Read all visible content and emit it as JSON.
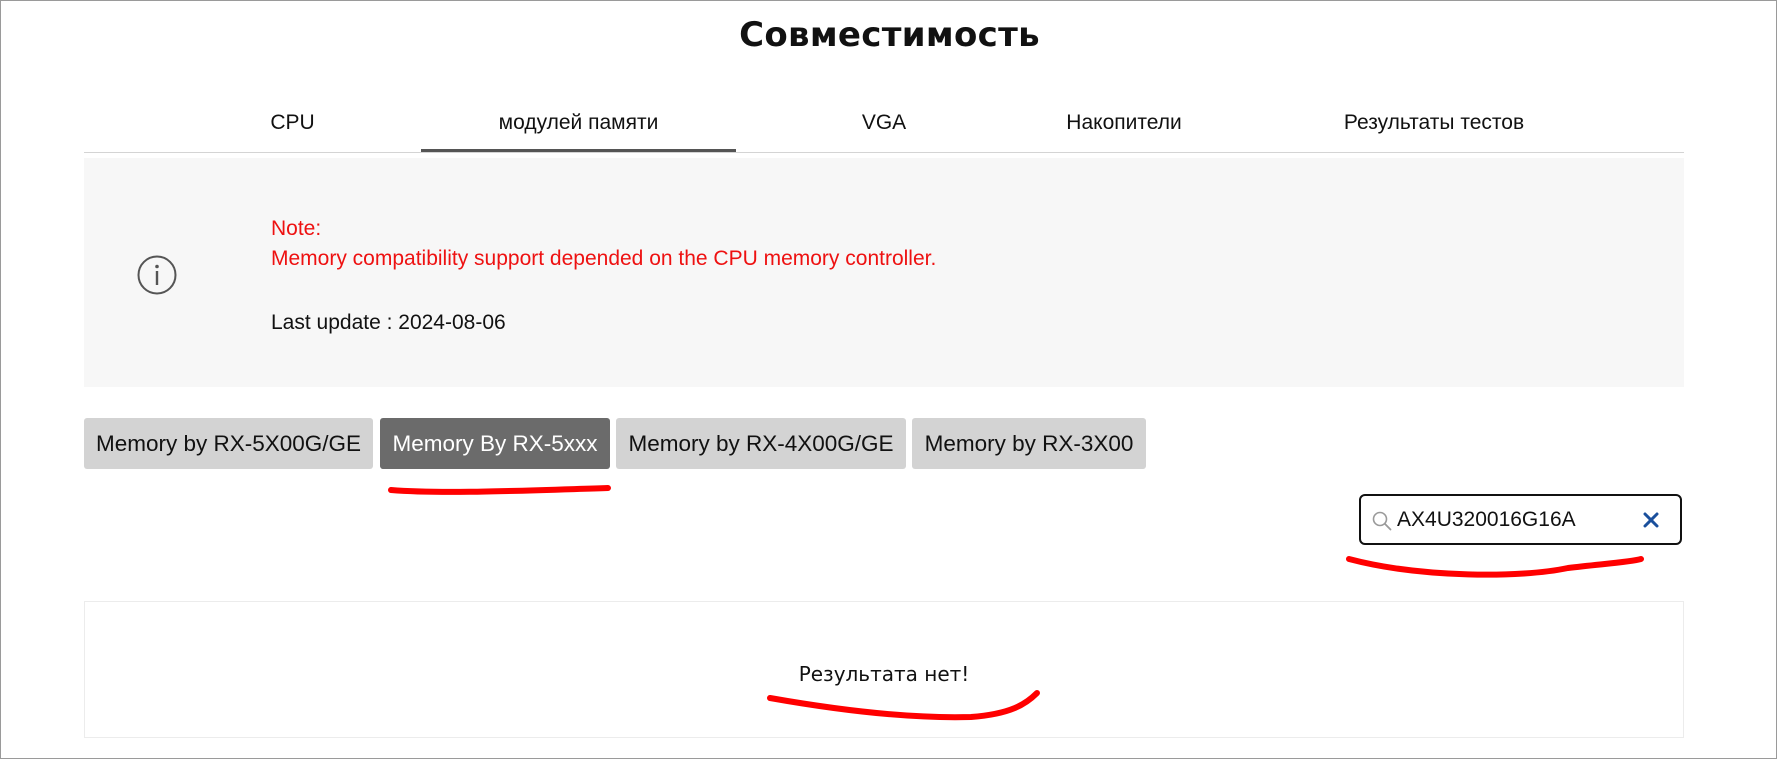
{
  "page": {
    "title": "Совместимость"
  },
  "tabs": [
    {
      "label": "CPU",
      "active": false
    },
    {
      "label": "модулей памяти",
      "active": true
    },
    {
      "label": "VGA",
      "active": false
    },
    {
      "label": "Накопители",
      "active": false
    },
    {
      "label": "Результаты тестов",
      "active": false
    }
  ],
  "note": {
    "icon": "info-icon",
    "label": "Note:",
    "text": "Memory compatibility support depended on the CPU memory controller.",
    "last_update": "Last update : 2024-08-06"
  },
  "memory_buttons": [
    {
      "label": "Memory by RX-5X00G/GE",
      "active": false
    },
    {
      "label": "Memory By RX-5xxx",
      "active": true
    },
    {
      "label": "Memory by RX-4X00G/GE",
      "active": false
    },
    {
      "label": "Memory by RX-3X00",
      "active": false
    }
  ],
  "search": {
    "value": "AX4U320016G16A",
    "icon": "search-icon",
    "clear_icon": "close-icon"
  },
  "results": {
    "empty_message": "Результата нет!"
  },
  "colors": {
    "note_text": "#ee1111",
    "active_button_bg": "#6b6b6b",
    "inactive_button_bg": "#d3d3d3",
    "note_bg": "#f7f7f7",
    "clear_icon": "#1a4f9c",
    "annotation": "#ff0000"
  }
}
